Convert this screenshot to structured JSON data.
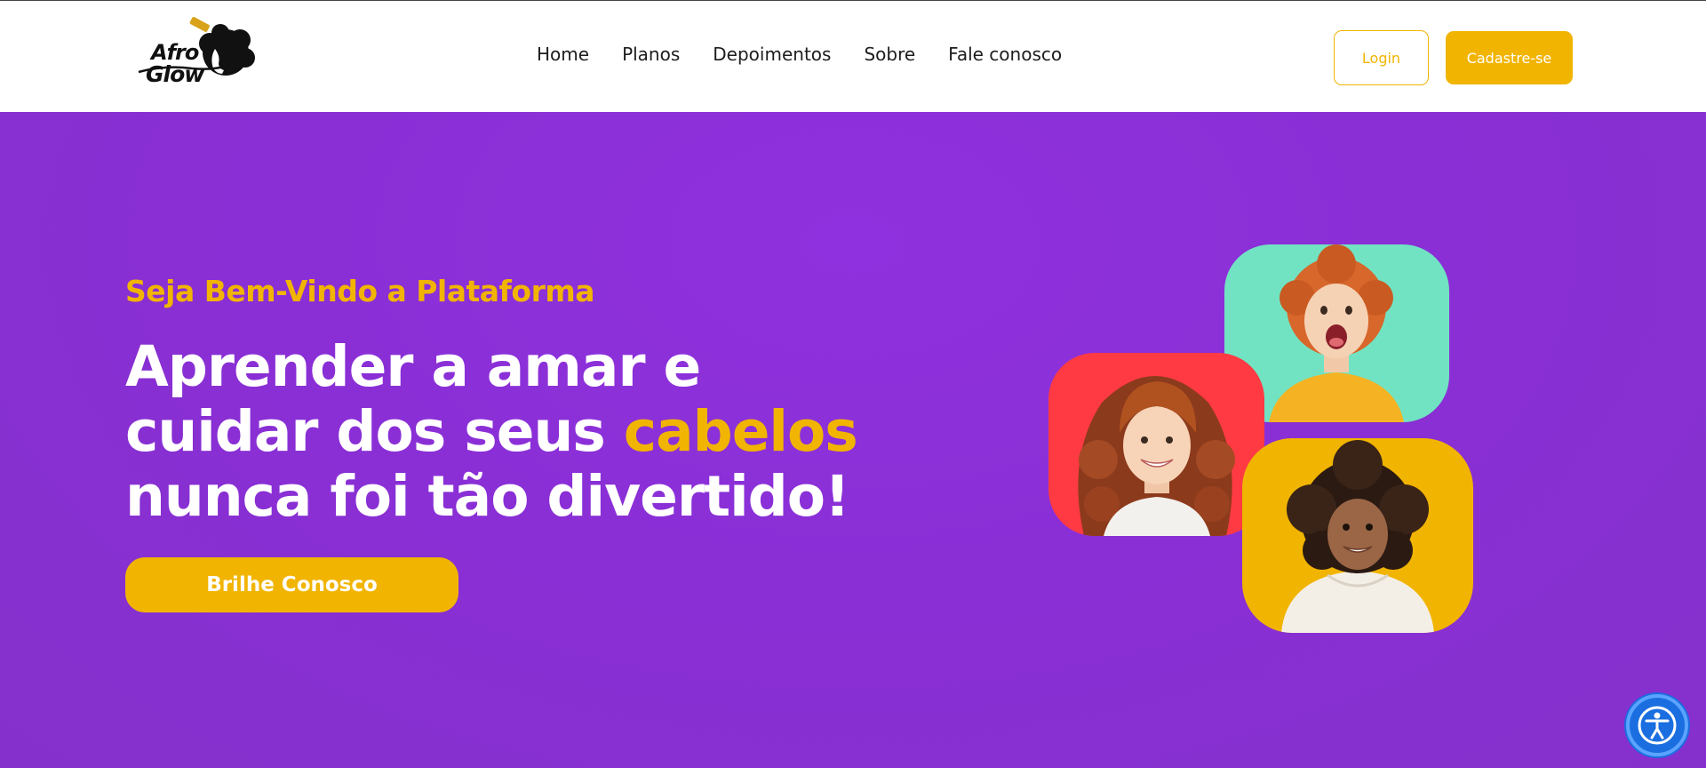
{
  "header": {
    "logo": {
      "line1": "Afro",
      "line2": "Glow"
    },
    "nav": [
      {
        "label": "Home"
      },
      {
        "label": "Planos"
      },
      {
        "label": "Depoimentos"
      },
      {
        "label": "Sobre"
      },
      {
        "label": "Fale conosco"
      }
    ],
    "login_label": "Login",
    "signup_label": "Cadastre-se"
  },
  "hero": {
    "welcome": "Seja Bem-Vindo a Plataforma",
    "headline": {
      "line1": "Aprender a amar e",
      "line2_start": "cuidar dos seus ",
      "line2_accent": "cabelos",
      "line3": "nunca foi tão divertido!"
    },
    "cta_label": "Brilhe Conosco",
    "photos": [
      {
        "subject": "laughing toddler with curly red hair",
        "background": "#71e3c2"
      },
      {
        "subject": "smiling girl with long curly red hair",
        "background": "#ff3a43"
      },
      {
        "subject": "smiling child with curly dark hair in white hoodie",
        "background": "#f1b400"
      }
    ]
  },
  "colors": {
    "brand_purple": "#8a2fd6",
    "brand_yellow": "#f1b400",
    "teal": "#71e3c2",
    "red": "#ff3a43",
    "accessibility_blue": "#1a6ee0"
  }
}
